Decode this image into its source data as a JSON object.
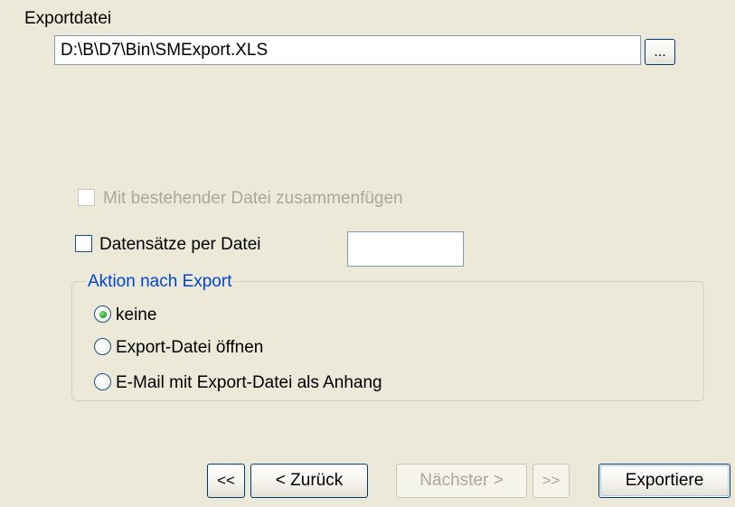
{
  "export_file": {
    "label": "Exportdatei",
    "path_value": "D:\\B\\D7\\Bin\\SMExport.XLS",
    "browse_label": "..."
  },
  "merge_option": {
    "label": "Mit bestehender Datei zusammenfügen",
    "checked": false,
    "enabled": false
  },
  "records_per_file": {
    "label": "Datensätze per Datei",
    "checked": false,
    "value": ""
  },
  "after_export": {
    "caption": "Aktion nach Export",
    "options": [
      {
        "label": "keine",
        "selected": true
      },
      {
        "label": "Export-Datei öffnen",
        "selected": false
      },
      {
        "label": "E-Mail mit Export-Datei als Anhang",
        "selected": false
      }
    ]
  },
  "navigation": {
    "first_label": "<<",
    "back_label": "< Zurück",
    "next_label": "Nächster >",
    "last_label": ">>",
    "export_label": "Exportiere"
  },
  "colors": {
    "background": "#ece9d8",
    "group_caption": "#0046d5",
    "disabled_text": "#aca899",
    "radio_selected": "#21a121"
  }
}
